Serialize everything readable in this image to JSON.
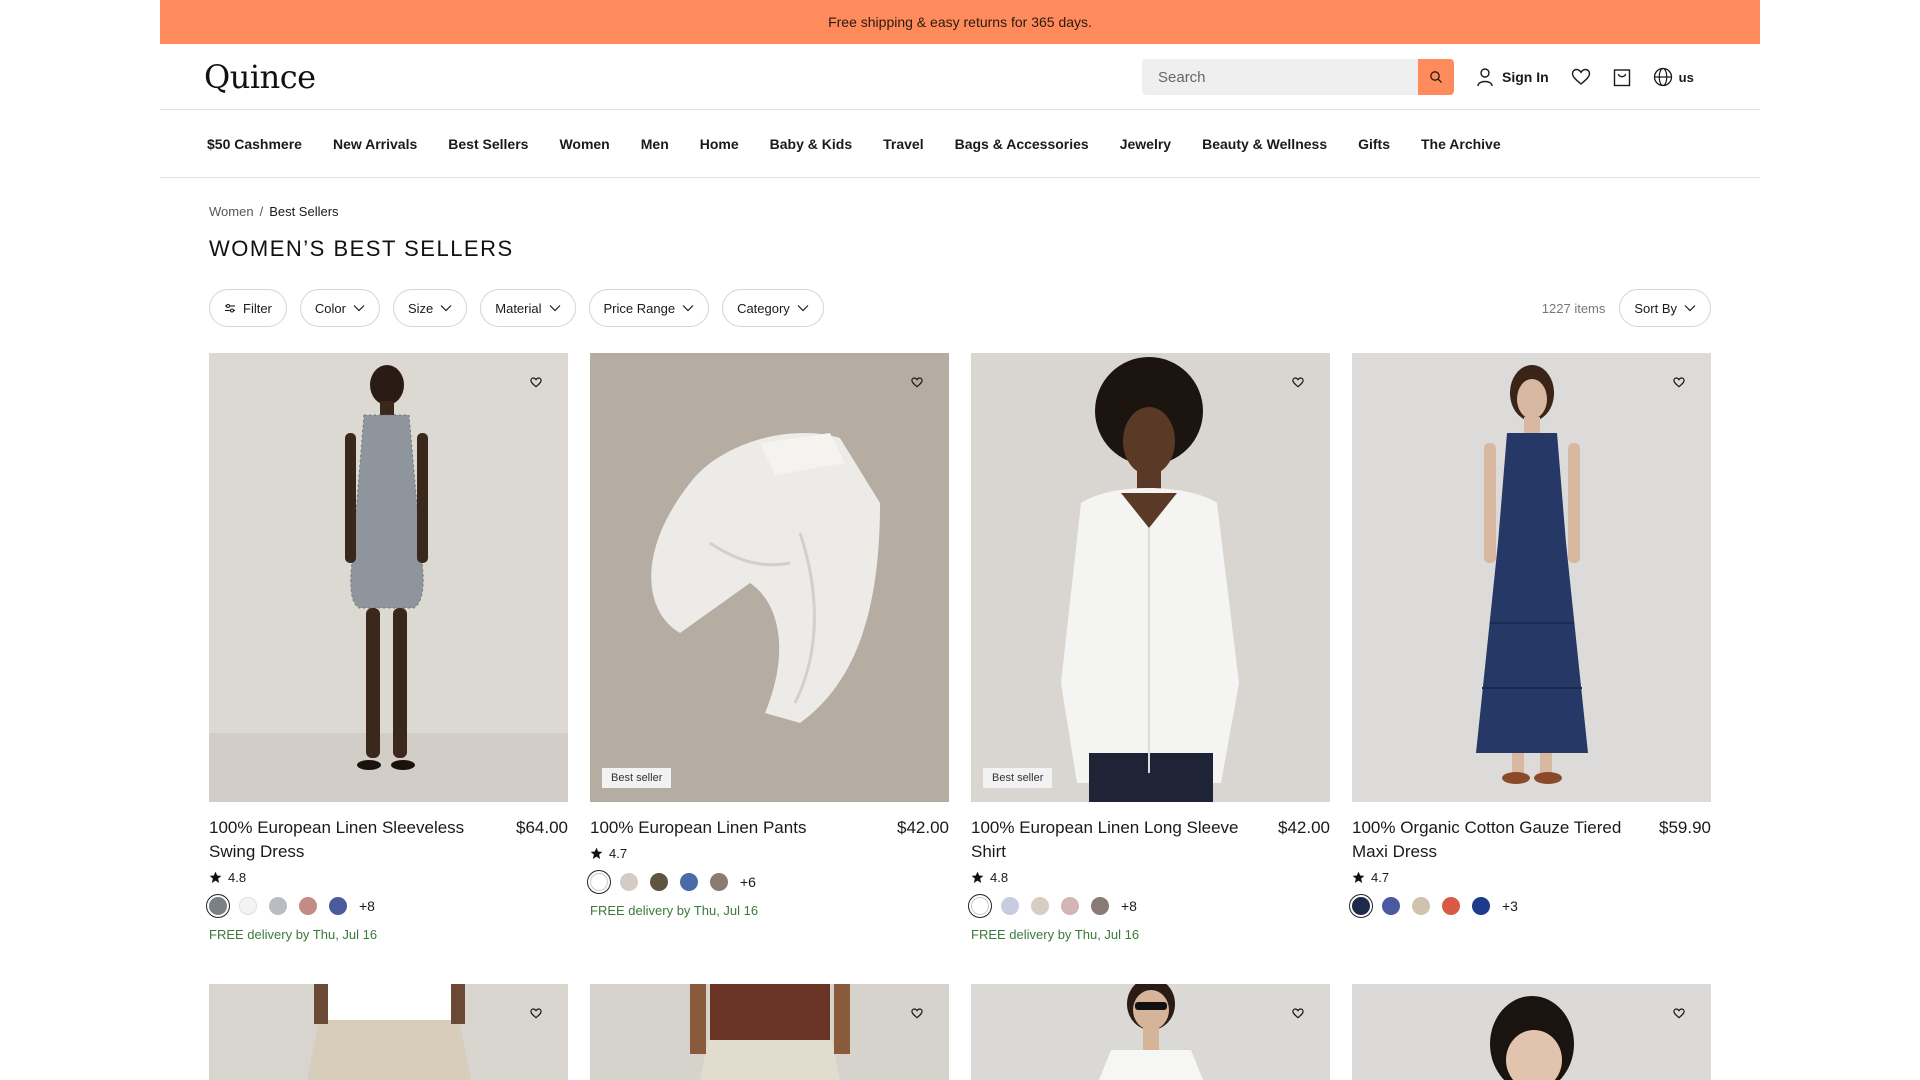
{
  "banner": {
    "text": "Free shipping & easy returns for 365 days."
  },
  "header": {
    "logo": "Quince",
    "search_placeholder": "Search",
    "sign_in": "Sign In",
    "locale": "us"
  },
  "nav": {
    "items": [
      "$50 Cashmere",
      "New Arrivals",
      "Best Sellers",
      "Women",
      "Men",
      "Home",
      "Baby & Kids",
      "Travel",
      "Bags & Accessories",
      "Jewelry",
      "Beauty & Wellness",
      "Gifts",
      "The Archive"
    ]
  },
  "breadcrumb": {
    "parent": "Women",
    "separator": "/",
    "current": "Best Sellers"
  },
  "page": {
    "title": "WOMEN’S BEST SELLERS"
  },
  "filters": {
    "filter": "Filter",
    "color": "Color",
    "size": "Size",
    "material": "Material",
    "price": "Price Range",
    "category": "Category"
  },
  "results": {
    "count": "1227 items",
    "sort": "Sort By"
  },
  "products": [
    {
      "name": "100% European Linen Sleeveless Swing Dress",
      "price": "$64.00",
      "rating": "4.8",
      "more_colors": "+8",
      "delivery": "FREE delivery by Thu, Jul 16",
      "badge": "",
      "swatches": [
        "#7a8088",
        "#f4f4f4",
        "#b8bcc4",
        "#c48a86",
        "#4a5a9a"
      ]
    },
    {
      "name": "100% European Linen Pants",
      "price": "$42.00",
      "rating": "4.7",
      "more_colors": "+6",
      "delivery": "FREE delivery by Thu, Jul 16",
      "badge": "Best seller",
      "swatches": [
        "#ffffff",
        "#d4ccc4",
        "#5e5440",
        "#4a6aa8",
        "#8a7a70"
      ]
    },
    {
      "name": "100% European Linen Long Sleeve Shirt",
      "price": "$42.00",
      "rating": "4.8",
      "more_colors": "+8",
      "delivery": "FREE delivery by Thu, Jul 16",
      "badge": "Best seller",
      "swatches": [
        "#ffffff",
        "#c8cce0",
        "#d6ccc2",
        "#d4b4b4",
        "#8a7a76"
      ]
    },
    {
      "name": "100% Organic Cotton Gauze Tiered Maxi Dress",
      "price": "$59.90",
      "rating": "4.7",
      "more_colors": "+3",
      "delivery": "",
      "badge": "",
      "swatches": [
        "#1e2a4a",
        "#4a5aa0",
        "#d0c2ae",
        "#d85a44",
        "#1e3a8a"
      ]
    }
  ],
  "colors": {
    "accent": "#ff8b5c",
    "delivery": "#3a7a3a"
  }
}
